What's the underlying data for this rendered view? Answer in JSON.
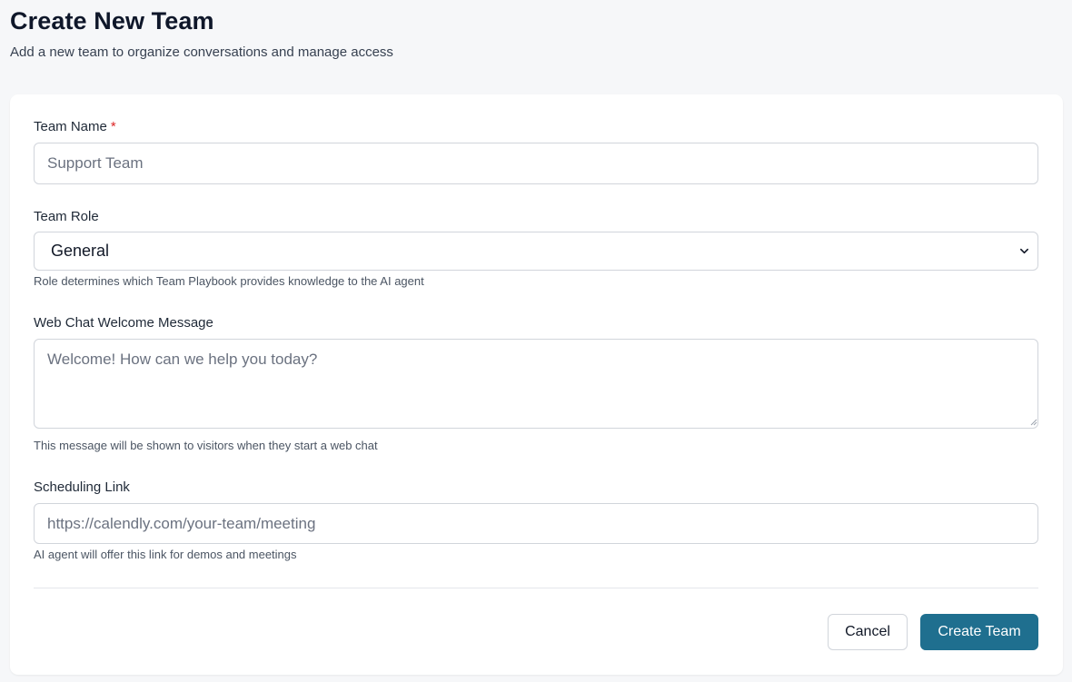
{
  "header": {
    "title": "Create New Team",
    "subtitle": "Add a new team to organize conversations and manage access"
  },
  "form": {
    "team_name": {
      "label": "Team Name",
      "required_mark": "*",
      "placeholder": "Support Team",
      "value": ""
    },
    "team_role": {
      "label": "Team Role",
      "selected": "General",
      "hint": "Role determines which Team Playbook provides knowledge to the AI agent",
      "icon": "chevron-down-icon"
    },
    "welcome_message": {
      "label": "Web Chat Welcome Message",
      "placeholder": "Welcome! How can we help you today?",
      "value": "",
      "hint": "This message will be shown to visitors when they start a web chat"
    },
    "scheduling_link": {
      "label": "Scheduling Link",
      "placeholder": "https://calendly.com/your-team/meeting",
      "value": "",
      "hint": "AI agent will offer this link for demos and meetings"
    }
  },
  "actions": {
    "cancel_label": "Cancel",
    "create_label": "Create Team"
  },
  "colors": {
    "primary": "#1f6f8f",
    "required": "#dc2626",
    "background": "#f6f7f9"
  }
}
